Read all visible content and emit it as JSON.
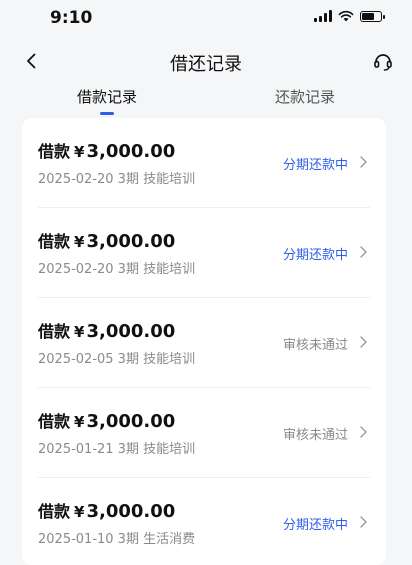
{
  "status_bar": {
    "time": "9:10"
  },
  "nav": {
    "title": "借还记录"
  },
  "tabs": [
    {
      "label": "借款记录",
      "active": true
    },
    {
      "label": "还款记录",
      "active": false
    }
  ],
  "records": [
    {
      "label": "借款",
      "currency": "¥",
      "amount": "3,000.00",
      "meta": "2025-02-20 3期  技能培训",
      "status": "分期还款中",
      "status_color": "#2f5ee8"
    },
    {
      "label": "借款",
      "currency": "¥",
      "amount": "3,000.00",
      "meta": "2025-02-20 3期  技能培训",
      "status": "分期还款中",
      "status_color": "#2f5ee8"
    },
    {
      "label": "借款",
      "currency": "¥",
      "amount": "3,000.00",
      "meta": "2025-02-05 3期  技能培训",
      "status": "审核未通过",
      "status_color": "#8a8a8a"
    },
    {
      "label": "借款",
      "currency": "¥",
      "amount": "3,000.00",
      "meta": "2025-01-21 3期  技能培训",
      "status": "审核未通过",
      "status_color": "#8a8a8a"
    },
    {
      "label": "借款",
      "currency": "¥",
      "amount": "3,000.00",
      "meta": "2025-01-10 3期  生活消费",
      "status": "分期还款中",
      "status_color": "#2f5ee8"
    }
  ],
  "colors": {
    "accent": "#2f5ee8",
    "muted": "#8a8a8a"
  }
}
